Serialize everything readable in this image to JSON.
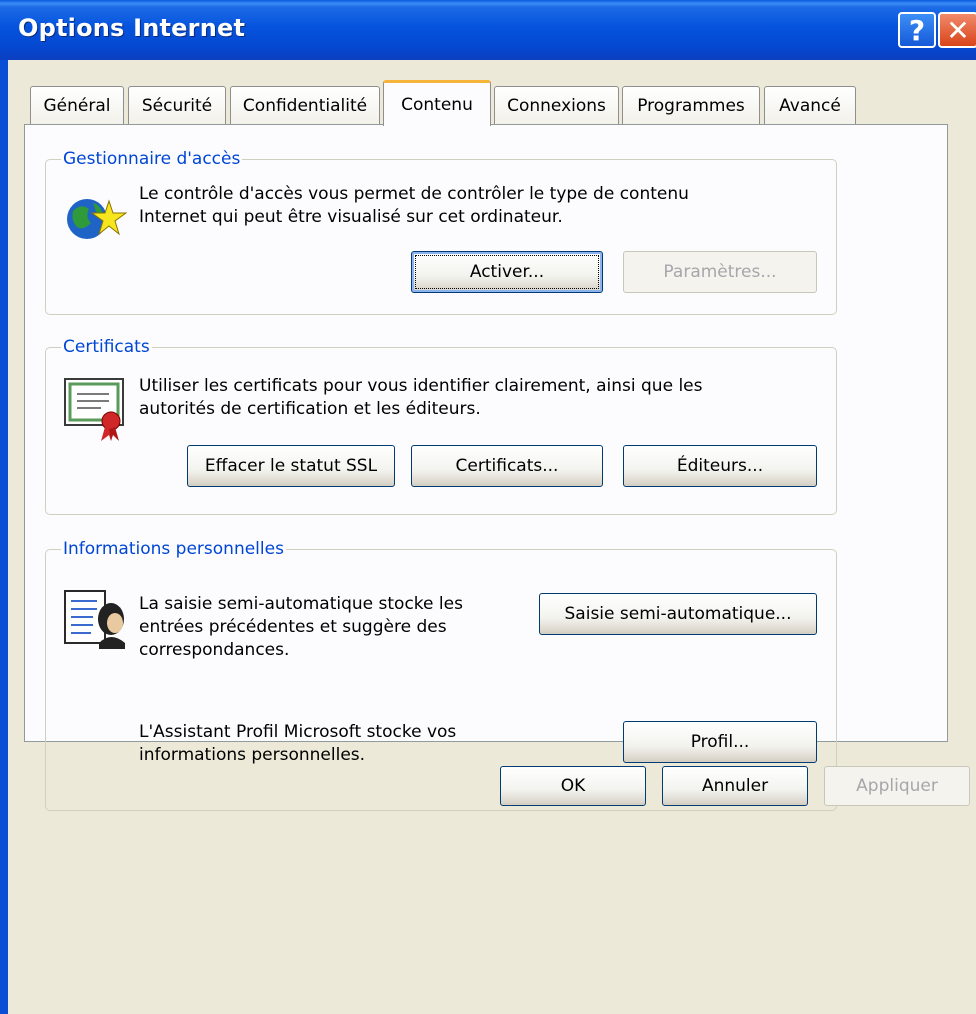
{
  "window": {
    "title": "Options Internet",
    "help_icon": "?",
    "close_icon": "✕"
  },
  "tabs": [
    {
      "label": "Général"
    },
    {
      "label": "Sécurité"
    },
    {
      "label": "Confidentialité"
    },
    {
      "label": "Contenu",
      "active": true
    },
    {
      "label": "Connexions"
    },
    {
      "label": "Programmes"
    },
    {
      "label": "Avancé"
    }
  ],
  "content_advisor": {
    "title": "Gestionnaire d'accès",
    "icon": "globe-star-icon",
    "description_line1": "Le contrôle d'accès vous permet de contrôler le type de contenu",
    "description_line2": "Internet qui peut être visualisé sur cet ordinateur.",
    "enable_button": "Activer...",
    "settings_button": "Paramètres..."
  },
  "certificates": {
    "title": "Certificats",
    "icon": "certificate-icon",
    "description_line1": "Utiliser les certificats pour vous identifier clairement, ainsi que les",
    "description_line2": "autorités de certification et les éditeurs.",
    "clear_ssl_button": "Effacer le statut SSL",
    "certificates_button": "Certificats...",
    "publishers_button": "Éditeurs..."
  },
  "personal_info": {
    "title": "Informations personnelles",
    "icon": "autocomplete-icon",
    "autocomplete_line1": "La saisie semi-automatique stocke les",
    "autocomplete_line2": "entrées précédentes et suggère des",
    "autocomplete_line3": "correspondances.",
    "autocomplete_button": "Saisie semi-automatique...",
    "profile_line1": "L'Assistant Profil Microsoft stocke vos",
    "profile_line2": "informations personnelles.",
    "profile_button": "Profil..."
  },
  "footer": {
    "ok_button": "OK",
    "cancel_button": "Annuler",
    "apply_button": "Appliquer"
  },
  "colors": {
    "titlebar": "#0553dd",
    "dialog_bg": "#ece9d8",
    "group_title": "#0046d5",
    "active_tab_accent": "#f6b43a"
  }
}
